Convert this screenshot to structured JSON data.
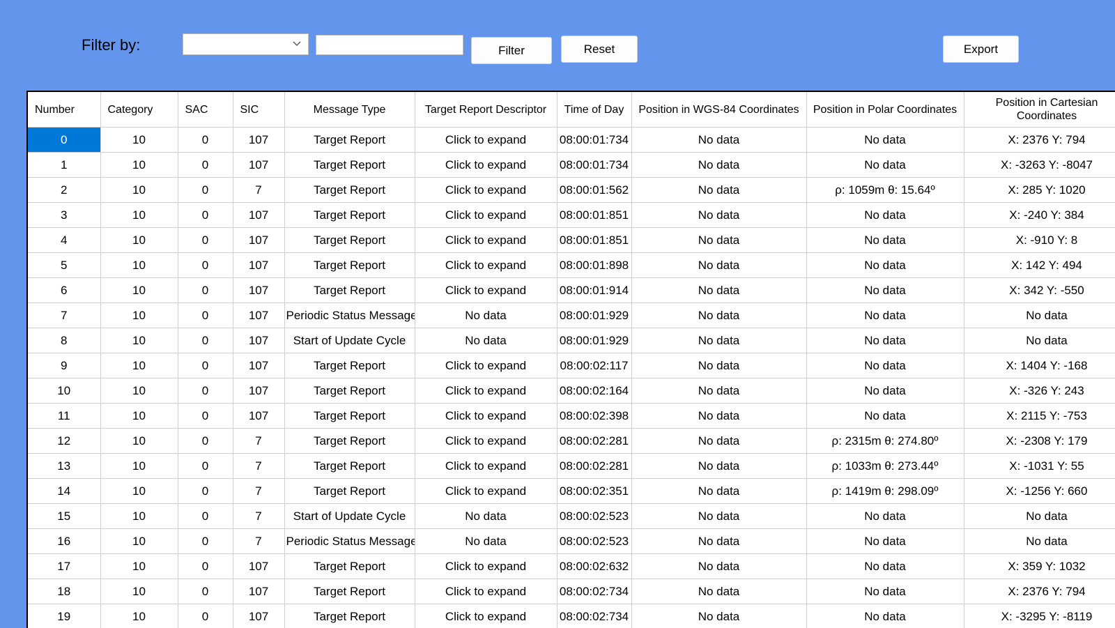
{
  "toolbar": {
    "filter_label": "Filter by:",
    "combo_value": "",
    "text_value": "",
    "filter_button": "Filter",
    "reset_button": "Reset",
    "export_button": "Export"
  },
  "table": {
    "columns": [
      "Number",
      "Category",
      "SAC",
      "SIC",
      "Message Type",
      "Target Report Descriptor",
      "Time of Day",
      "Position in WGS-84 Coordinates",
      "Position in Polar Coordinates",
      "Position in Cartesian Coordinates"
    ],
    "selected_row": 0,
    "rows": [
      [
        "0",
        "10",
        "0",
        "107",
        "Target Report",
        "Click to expand",
        "08:00:01:734",
        "No data",
        "No data",
        "X: 2376 Y: 794"
      ],
      [
        "1",
        "10",
        "0",
        "107",
        "Target Report",
        "Click to expand",
        "08:00:01:734",
        "No data",
        "No data",
        "X: -3263 Y: -8047"
      ],
      [
        "2",
        "10",
        "0",
        "7",
        "Target Report",
        "Click to expand",
        "08:00:01:562",
        "No data",
        "ρ: 1059m θ: 15.64º",
        "X: 285 Y: 1020"
      ],
      [
        "3",
        "10",
        "0",
        "107",
        "Target Report",
        "Click to expand",
        "08:00:01:851",
        "No data",
        "No data",
        "X: -240 Y: 384"
      ],
      [
        "4",
        "10",
        "0",
        "107",
        "Target Report",
        "Click to expand",
        "08:00:01:851",
        "No data",
        "No data",
        "X: -910 Y: 8"
      ],
      [
        "5",
        "10",
        "0",
        "107",
        "Target Report",
        "Click to expand",
        "08:00:01:898",
        "No data",
        "No data",
        "X: 142 Y: 494"
      ],
      [
        "6",
        "10",
        "0",
        "107",
        "Target Report",
        "Click to expand",
        "08:00:01:914",
        "No data",
        "No data",
        "X: 342 Y: -550"
      ],
      [
        "7",
        "10",
        "0",
        "107",
        "Periodic Status Message",
        "No data",
        "08:00:01:929",
        "No data",
        "No data",
        "No data"
      ],
      [
        "8",
        "10",
        "0",
        "107",
        "Start of Update Cycle",
        "No data",
        "08:00:01:929",
        "No data",
        "No data",
        "No data"
      ],
      [
        "9",
        "10",
        "0",
        "107",
        "Target Report",
        "Click to expand",
        "08:00:02:117",
        "No data",
        "No data",
        "X: 1404 Y: -168"
      ],
      [
        "10",
        "10",
        "0",
        "107",
        "Target Report",
        "Click to expand",
        "08:00:02:164",
        "No data",
        "No data",
        "X: -326 Y: 243"
      ],
      [
        "11",
        "10",
        "0",
        "107",
        "Target Report",
        "Click to expand",
        "08:00:02:398",
        "No data",
        "No data",
        "X: 2115 Y: -753"
      ],
      [
        "12",
        "10",
        "0",
        "7",
        "Target Report",
        "Click to expand",
        "08:00:02:281",
        "No data",
        "ρ: 2315m θ: 274.80º",
        "X: -2308 Y: 179"
      ],
      [
        "13",
        "10",
        "0",
        "7",
        "Target Report",
        "Click to expand",
        "08:00:02:281",
        "No data",
        "ρ: 1033m θ: 273.44º",
        "X: -1031 Y: 55"
      ],
      [
        "14",
        "10",
        "0",
        "7",
        "Target Report",
        "Click to expand",
        "08:00:02:351",
        "No data",
        "ρ: 1419m θ: 298.09º",
        "X: -1256 Y: 660"
      ],
      [
        "15",
        "10",
        "0",
        "7",
        "Start of Update Cycle",
        "No data",
        "08:00:02:523",
        "No data",
        "No data",
        "No data"
      ],
      [
        "16",
        "10",
        "0",
        "7",
        "Periodic Status Message",
        "No data",
        "08:00:02:523",
        "No data",
        "No data",
        "No data"
      ],
      [
        "17",
        "10",
        "0",
        "107",
        "Target Report",
        "Click to expand",
        "08:00:02:632",
        "No data",
        "No data",
        "X: 359 Y: 1032"
      ],
      [
        "18",
        "10",
        "0",
        "107",
        "Target Report",
        "Click to expand",
        "08:00:02:734",
        "No data",
        "No data",
        "X: 2376 Y: 794"
      ],
      [
        "19",
        "10",
        "0",
        "107",
        "Target Report",
        "Click to expand",
        "08:00:02:734",
        "No data",
        "No data",
        "X: -3295 Y: -8119"
      ]
    ]
  }
}
